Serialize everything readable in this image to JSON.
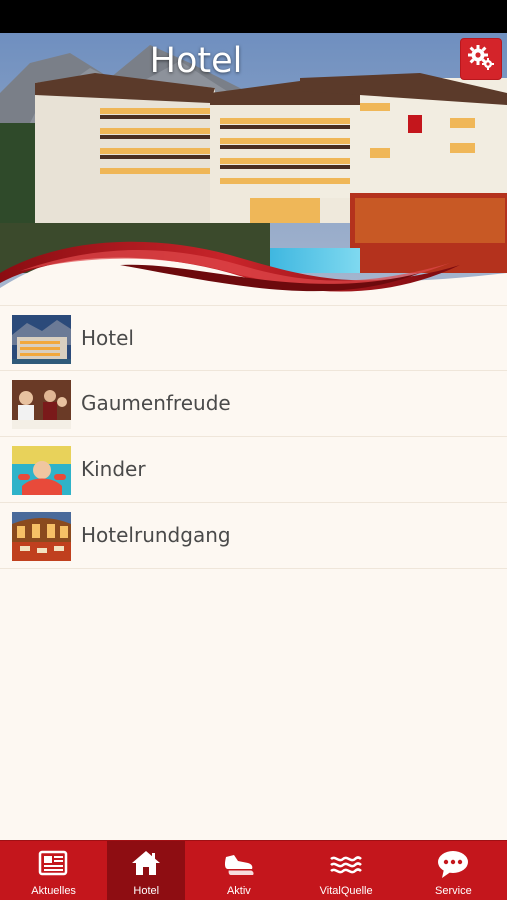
{
  "header": {
    "title": "Hotel",
    "settings_icon": "gear-icon"
  },
  "menu": {
    "items": [
      {
        "label": "Hotel",
        "thumb": "hotel-exterior"
      },
      {
        "label": "Gaumenfreude",
        "thumb": "dining-people"
      },
      {
        "label": "Kinder",
        "thumb": "child-pool"
      },
      {
        "label": "Hotelrundgang",
        "thumb": "hotel-interior"
      }
    ]
  },
  "tabbar": {
    "tabs": [
      {
        "label": "Aktuelles",
        "icon": "newspaper-icon",
        "active": false
      },
      {
        "label": "Hotel",
        "icon": "home-icon",
        "active": true
      },
      {
        "label": "Aktiv",
        "icon": "shoes-icon",
        "active": false
      },
      {
        "label": "VitalQuelle",
        "icon": "waves-icon",
        "active": false
      },
      {
        "label": "Service",
        "icon": "chat-bubble-icon",
        "active": false
      }
    ]
  },
  "colors": {
    "brand_red": "#c4161c",
    "active_tab": "#8e0d12",
    "background": "#fdf8f2",
    "text": "#4a4a4a"
  }
}
